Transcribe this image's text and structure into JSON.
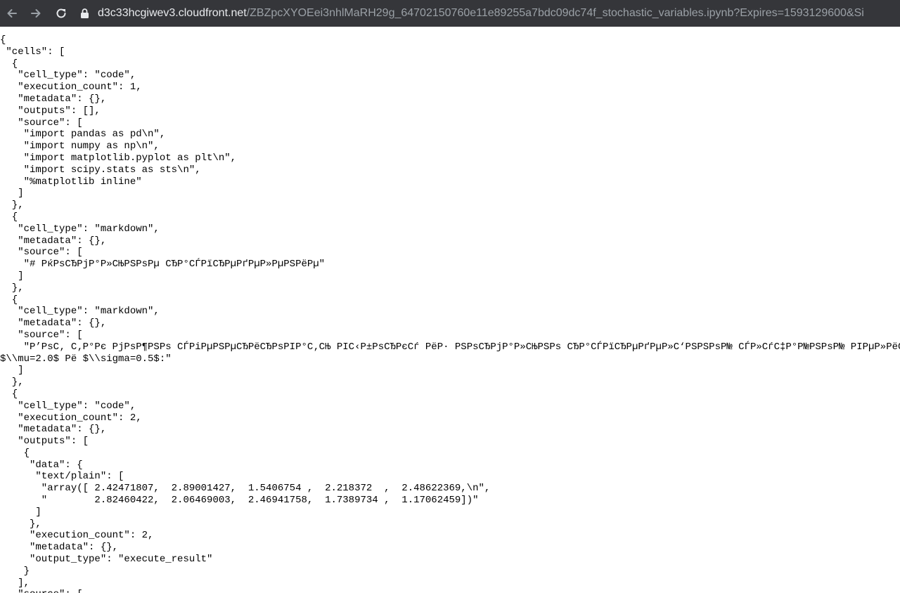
{
  "browser": {
    "url_host": "d3c33hcgiwev3.cloudfront.net",
    "url_path": "/ZBZpcXYOEei3nhlMaRH29g_64702150760e11e89255a7bdc09dc74f_stochastic_variables.ipynb?Expires=1593129600&Si"
  },
  "document": {
    "lines": [
      "{",
      " \"cells\": [",
      "  {",
      "   \"cell_type\": \"code\",",
      "   \"execution_count\": 1,",
      "   \"metadata\": {},",
      "   \"outputs\": [],",
      "   \"source\": [",
      "    \"import pandas as pd\\n\",",
      "    \"import numpy as np\\n\",",
      "    \"import matplotlib.pyplot as plt\\n\",",
      "    \"import scipy.stats as sts\\n\",",
      "    \"%matplotlib inline\"",
      "   ]",
      "  },",
      "  {",
      "   \"cell_type\": \"markdown\",",
      "   \"metadata\": {},",
      "   \"source\": [",
      "    \"# РќРѕСЂРјР°Р»СЊРЅРѕРµ СЂР°СЃРїСЂРµРґРµР»РµРЅРёРµ\"",
      "   ]",
      "  },",
      "  {",
      "   \"cell_type\": \"markdown\",",
      "   \"metadata\": {},",
      "   \"source\": [",
      "    \"Р’РѕС‚ С‚Р°Рє РјРѕР¶РЅРѕ СЃРіРµРЅРµСЂРёСЂРѕРІР°С‚СЊ РІС‹Р±РѕСЂРєСѓ РёР· РЅРѕСЂРјР°Р»СЊРЅРѕ СЂР°СЃРїСЂРµРґРµР»С‘РЅРЅРѕР№ СЃР»СѓС‡Р°Р№РЅРѕР№ РІРµР»РёС‡РёРЅС‹",
      "$\\\\mu=2.0$ Рё $\\\\sigma=0.5$:\"",
      "   ]",
      "  },",
      "  {",
      "   \"cell_type\": \"code\",",
      "   \"execution_count\": 2,",
      "   \"metadata\": {},",
      "   \"outputs\": [",
      "    {",
      "     \"data\": {",
      "      \"text/plain\": [",
      "       \"array([ 2.42471807,  2.89001427,  1.5406754 ,  2.218372  ,  2.48622369,\\n\",",
      "       \"        2.82460422,  2.06469003,  2.46941758,  1.7389734 ,  1.17062459])\"",
      "      ]",
      "     },",
      "     \"execution_count\": 2,",
      "     \"metadata\": {},",
      "     \"output_type\": \"execute_result\"",
      "    }",
      "   ],",
      "   \"source\": ["
    ]
  }
}
